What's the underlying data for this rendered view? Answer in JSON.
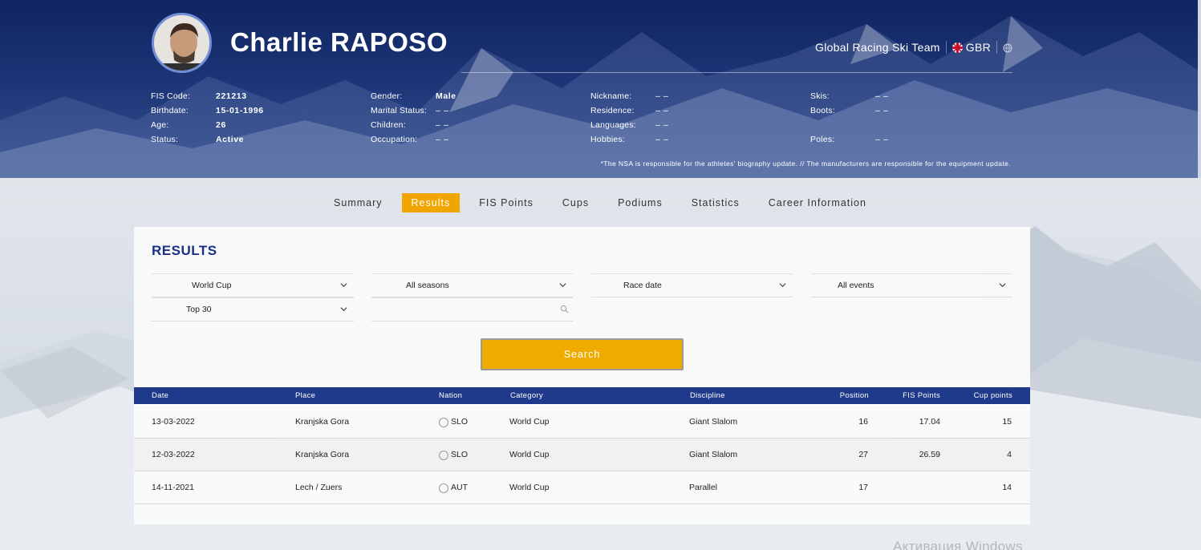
{
  "athlete": {
    "name": "Charlie RAPOSO",
    "team": "Global Racing Ski Team",
    "nation": "GBR"
  },
  "bio": {
    "col1": [
      {
        "label": "FIS Code:",
        "value": "221213"
      },
      {
        "label": "Birthdate:",
        "value": "15-01-1996"
      },
      {
        "label": "Age:",
        "value": "26"
      },
      {
        "label": "Status:",
        "value": "Active"
      }
    ],
    "col2": [
      {
        "label": "Gender:",
        "value": "Male"
      },
      {
        "label": "Marital Status:",
        "value": "– –"
      },
      {
        "label": "Children:",
        "value": "– –"
      },
      {
        "label": "Occupation:",
        "value": "– –"
      }
    ],
    "col3": [
      {
        "label": "Nickname:",
        "value": "– –"
      },
      {
        "label": "Residence:",
        "value": "– –"
      },
      {
        "label": "Languages:",
        "value": "– –"
      },
      {
        "label": "Hobbies:",
        "value": "– –"
      }
    ],
    "col4": [
      {
        "label": "Skis:",
        "value": "– –"
      },
      {
        "label": "Boots:",
        "value": "– –"
      },
      {
        "label": "",
        "value": ""
      },
      {
        "label": "Poles:",
        "value": "– –"
      }
    ]
  },
  "disclaimer": "*The NSA is responsible for the athletes' biography update. // The manufacturers are responsible for the equipment update.",
  "tabs": [
    "Summary",
    "Results",
    "FIS Points",
    "Cups",
    "Podiums",
    "Statistics",
    "Career Information"
  ],
  "active_tab": "Results",
  "results": {
    "title": "RESULTS",
    "filters": {
      "category": "World Cup",
      "season": "All seasons",
      "sort": "Race date",
      "event": "All events",
      "limit": "Top 30",
      "search_value": ""
    },
    "search_label": "Search",
    "columns": [
      "Date",
      "Place",
      "Nation",
      "Category",
      "Discipline",
      "Position",
      "FIS Points",
      "Cup points"
    ],
    "rows": [
      {
        "date": "13-03-2022",
        "place": "Kranjska Gora",
        "nation": "SLO",
        "category": "World Cup",
        "discipline": "Giant Slalom",
        "position": "16",
        "fis_points": "17.04",
        "cup_points": "15"
      },
      {
        "date": "12-03-2022",
        "place": "Kranjska Gora",
        "nation": "SLO",
        "category": "World Cup",
        "discipline": "Giant Slalom",
        "position": "27",
        "fis_points": "26.59",
        "cup_points": "4"
      },
      {
        "date": "14-11-2021",
        "place": "Lech / Zuers",
        "nation": "AUT",
        "category": "World Cup",
        "discipline": "Parallel",
        "position": "17",
        "fis_points": "",
        "cup_points": "14"
      }
    ]
  },
  "watermark": "Активация Windows",
  "colors": {
    "header_blue": "#1d3577",
    "accent_orange": "#f0a500",
    "table_header": "#1f3a8a",
    "title_blue": "#1a2f85"
  },
  "icons": [
    "avatar-photo",
    "uk-flag-icon",
    "globe-icon",
    "chevron-down-icon",
    "search-icon",
    "slovenia-flag-icon",
    "austria-flag-icon"
  ]
}
